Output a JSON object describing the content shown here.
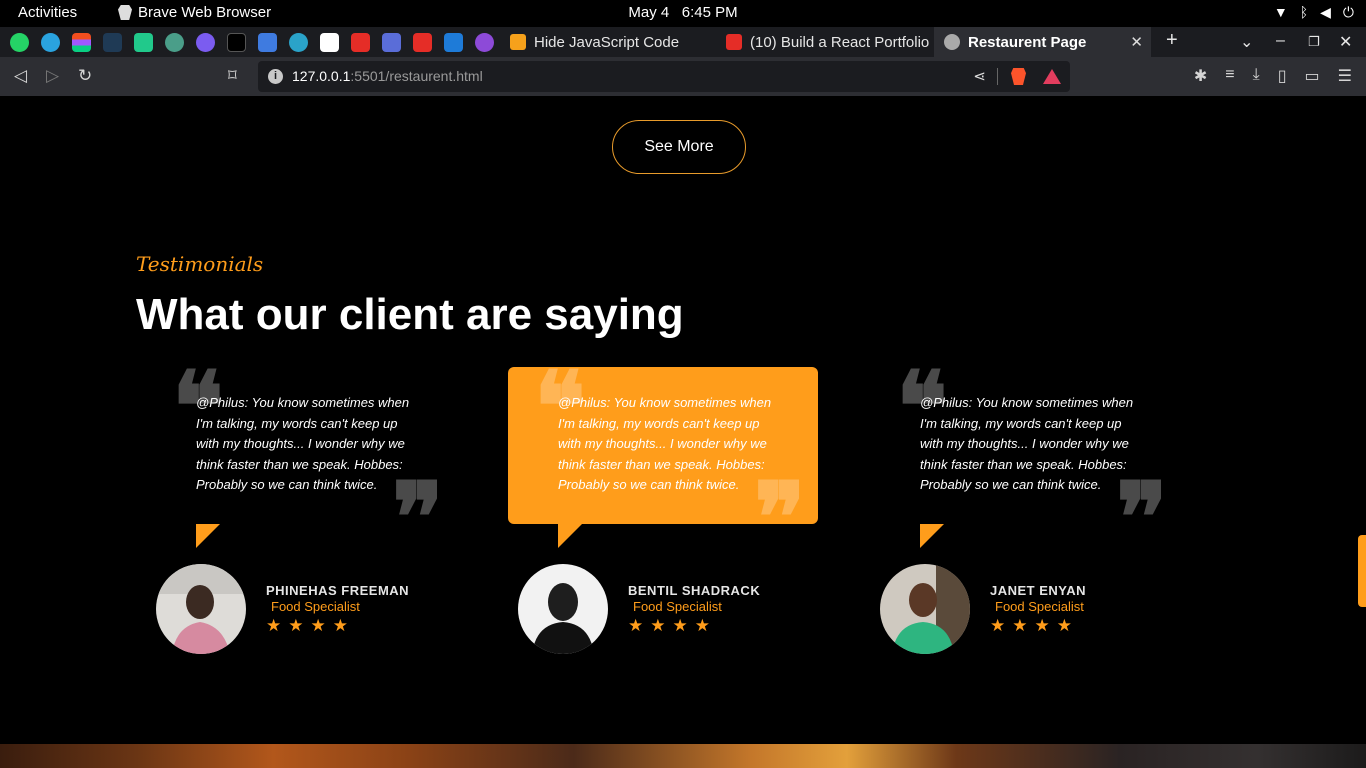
{
  "system_bar": {
    "activities": "Activities",
    "app_name": "Brave Web Browser",
    "date": "May 4",
    "time": "6:45 PM"
  },
  "browser": {
    "pinned_icons": [
      "whatsapp-icon",
      "telegram-icon",
      "figma-icon",
      "app-icon",
      "app-icon",
      "chatgpt-icon",
      "messenger-icon",
      "app-icon",
      "docs-icon",
      "app-icon",
      "frontend-mentor-icon",
      "youtube-icon",
      "app-icon",
      "youtube-icon",
      "app-icon",
      "app-icon"
    ],
    "tabs": [
      {
        "label": "Hide JavaScript Code",
        "icon": "bookmark-icon"
      },
      {
        "label": "(10) Build a React Portfolio",
        "icon": "youtube-icon"
      },
      {
        "label": "Restaurent Page",
        "icon": "globe-icon",
        "active": true
      }
    ],
    "url_host": "127.0.0.1",
    "url_rest": ":5501/restaurent.html"
  },
  "page": {
    "see_more": "See More",
    "kicker": "Testimonials",
    "heading": "What our client are saying",
    "testimonials": [
      {
        "quote": "@Philus: You know sometimes when I'm talking, my words can't keep up with my thoughts... I wonder why we think faster than we speak. Hobbes: Probably so we can think twice.",
        "name": "PHINEHAS FREEMAN",
        "role": "Food Specialist",
        "rating": 4,
        "highlighted": false
      },
      {
        "quote": "@Philus: You know sometimes when I'm talking, my words can't keep up with my thoughts... I wonder why we think faster than we speak. Hobbes: Probably so we can think twice.",
        "name": "BENTIL SHADRACK",
        "role": "Food Specialist",
        "rating": 4,
        "highlighted": true
      },
      {
        "quote": "@Philus: You know sometimes when I'm talking, my words can't keep up with my thoughts... I wonder why we think faster than we speak. Hobbes: Probably so we can think twice.",
        "name": "JANET ENYAN",
        "role": "Food Specialist",
        "rating": 4,
        "highlighted": false
      }
    ],
    "accent_color": "#ff9d1b"
  }
}
